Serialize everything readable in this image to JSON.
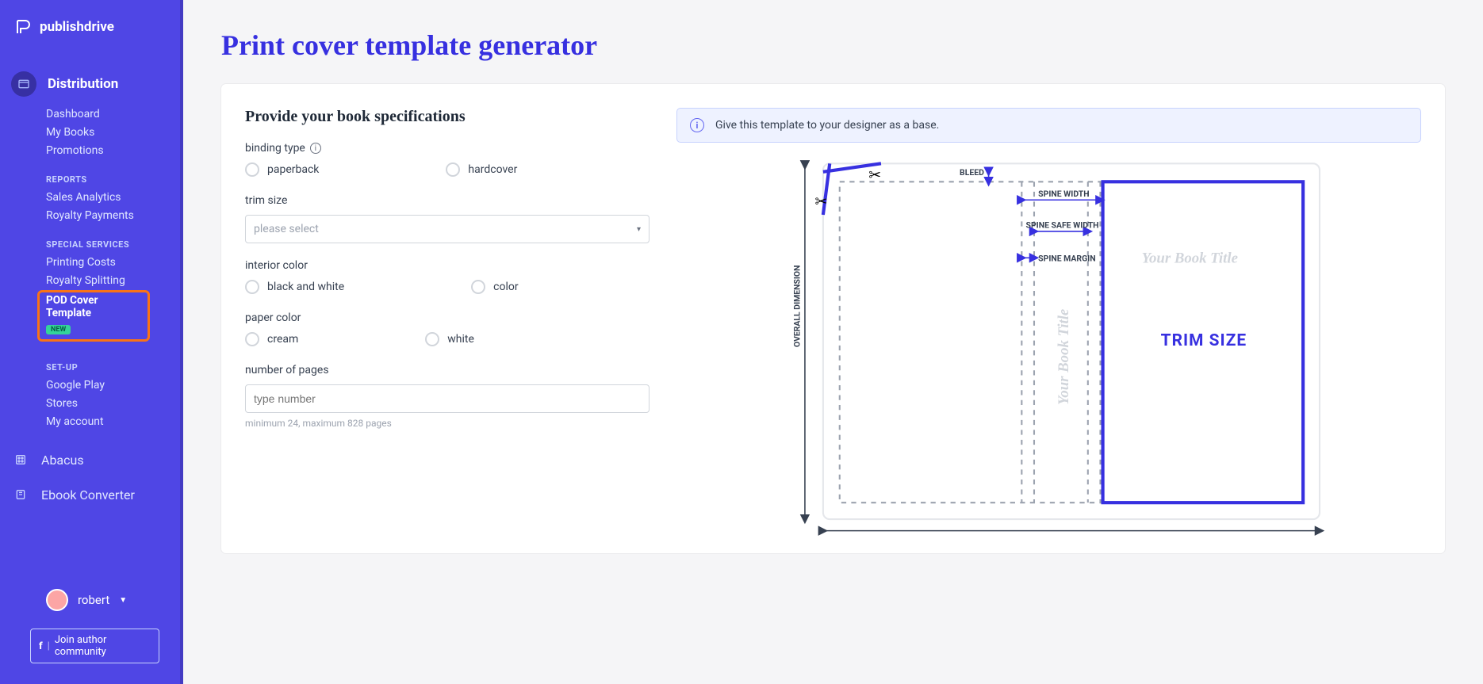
{
  "brand": "publishdrive",
  "sidebar": {
    "distribution": {
      "label": "Distribution",
      "items": [
        "Dashboard",
        "My Books",
        "Promotions"
      ]
    },
    "reports": {
      "heading": "REPORTS",
      "items": [
        "Sales Analytics",
        "Royalty Payments"
      ]
    },
    "special": {
      "heading": "SPECIAL SERVICES",
      "items": [
        "Printing Costs",
        "Royalty Splitting"
      ],
      "highlighted": "POD Cover Template",
      "badge": "NEW"
    },
    "setup": {
      "heading": "SET-UP",
      "items": [
        "Google Play",
        "Stores",
        "My account"
      ]
    },
    "bottom": [
      "Abacus",
      "Ebook Converter"
    ],
    "user": "robert",
    "join": "Join author community"
  },
  "page": {
    "title": "Print cover template generator",
    "formHeading": "Provide your book specifications",
    "bindingLabel": "binding type",
    "bindingOptions": [
      "paperback",
      "hardcover"
    ],
    "trimLabel": "trim size",
    "trimPlaceholder": "please select",
    "interiorLabel": "interior color",
    "interiorOptions": [
      "black and white",
      "color"
    ],
    "paperLabel": "paper color",
    "paperOptions": [
      "cream",
      "white"
    ],
    "pagesLabel": "number of pages",
    "pagesPlaceholder": "type number",
    "pagesHelper": "minimum 24, maximum 828 pages"
  },
  "preview": {
    "banner": "Give this template to your designer as a base.",
    "bleed": "BLEED",
    "spineWidth": "SPINE WIDTH",
    "spineSafe": "SPINE SAFE WIDTH",
    "spineMargin": "SPINE MARGIN",
    "yourTitle": "Your Book Title",
    "trimSize": "TRIM SIZE",
    "overall": "OVERALL DIMENSION"
  }
}
